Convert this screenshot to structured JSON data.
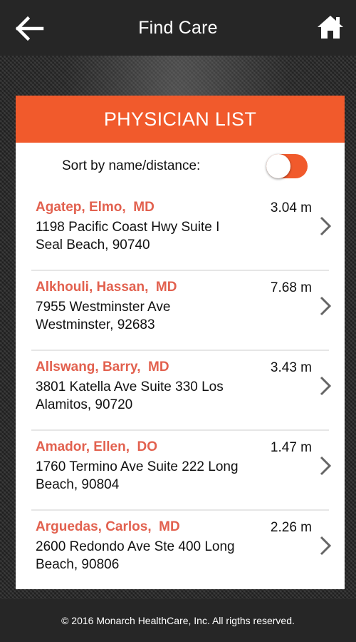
{
  "header": {
    "title": "Find Care",
    "back_icon": "arrow-left-icon",
    "home_icon": "home-icon"
  },
  "card": {
    "title": "PHYSICIAN LIST",
    "sort_label": "Sort by name/distance:",
    "sort_toggle_on": true
  },
  "physicians": [
    {
      "name": "Agatep, Elmo,  MD",
      "distance": "3.04 m",
      "address_line1": "1198 Pacific Coast Hwy Suite I",
      "address_line2": "Seal Beach, 90740"
    },
    {
      "name": "Alkhouli, Hassan,  MD",
      "distance": "7.68 m",
      "address_line1": "7955 Westminster Ave",
      "address_line2": "Westminster, 92683"
    },
    {
      "name": "Allswang, Barry,  MD",
      "distance": "3.43 m",
      "address_line1": "3801 Katella Ave Suite 330 Los",
      "address_line2": "Alamitos, 90720"
    },
    {
      "name": "Amador, Ellen,  DO",
      "distance": "1.47 m",
      "address_line1": "1760 Termino Ave Suite 222 Long",
      "address_line2": "Beach, 90804"
    },
    {
      "name": "Arguedas, Carlos,  MD",
      "distance": "2.26 m",
      "address_line1": "2600 Redondo Ave Ste 400 Long",
      "address_line2": "Beach, 90806"
    }
  ],
  "footer": {
    "text": "© 2016 Monarch HealthCare, Inc. All rigths reserved."
  },
  "colors": {
    "accent": "#f15a2c",
    "name_text": "#e2614f",
    "bar_bg": "#262626"
  }
}
